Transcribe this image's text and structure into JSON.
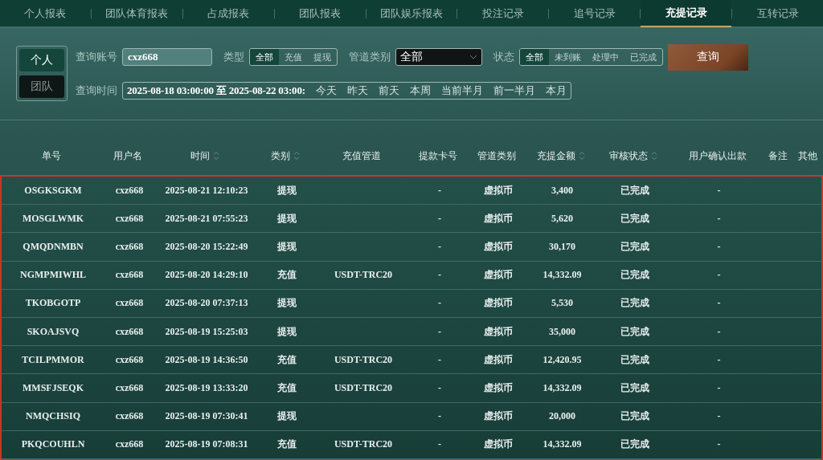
{
  "tabs": [
    {
      "label": "个人报表",
      "selected": false
    },
    {
      "label": "团队体育报表",
      "selected": false
    },
    {
      "label": "占成报表",
      "selected": false
    },
    {
      "label": "团队报表",
      "selected": false
    },
    {
      "label": "团队娱乐报表",
      "selected": false
    },
    {
      "label": "投注记录",
      "selected": false
    },
    {
      "label": "追号记录",
      "selected": false
    },
    {
      "label": "充提记录",
      "selected": true
    },
    {
      "label": "互转记录",
      "selected": false
    }
  ],
  "scope": [
    {
      "label": "个人",
      "selected": true
    },
    {
      "label": "团队",
      "selected": false
    }
  ],
  "filters": {
    "account_label": "查询账号",
    "account_value": "cxz668",
    "type_label": "类型",
    "type_options": [
      {
        "label": "全部",
        "selected": true
      },
      {
        "label": "充值",
        "selected": false
      },
      {
        "label": "提现",
        "selected": false
      }
    ],
    "channel_label": "管道类别",
    "channel_value": "全部",
    "status_label": "状态",
    "status_options": [
      {
        "label": "全部",
        "selected": true
      },
      {
        "label": "未到账",
        "selected": false
      },
      {
        "label": "处理中",
        "selected": false
      },
      {
        "label": "已完成",
        "selected": false
      }
    ],
    "query_button": "查询",
    "time_label": "查询时间",
    "time_range": "2025-08-18 03:00:00 至 2025-08-22 03:00:",
    "quick_ranges": [
      "今天",
      "昨天",
      "前天",
      "本周",
      "当前半月",
      "前一半月",
      "本月"
    ]
  },
  "table": {
    "columns": [
      {
        "label": "单号",
        "sortable": false
      },
      {
        "label": "用户名",
        "sortable": false
      },
      {
        "label": "时间",
        "sortable": true
      },
      {
        "label": "类别",
        "sortable": true
      },
      {
        "label": "充值管道",
        "sortable": false
      },
      {
        "label": "提款卡号",
        "sortable": false
      },
      {
        "label": "管道类别",
        "sortable": false
      },
      {
        "label": "充提金额",
        "sortable": true
      },
      {
        "label": "审核状态",
        "sortable": true
      },
      {
        "label": "用户确认出款",
        "sortable": false
      },
      {
        "label": "备注",
        "sortable": false
      },
      {
        "label": "其他",
        "sortable": false
      }
    ],
    "rows": [
      [
        "OSGKSGKM",
        "cxz668",
        "2025-08-21 12:10:23",
        "提现",
        "",
        "-",
        "虚拟币",
        "3,400",
        "已完成",
        "-"
      ],
      [
        "MOSGLWMK",
        "cxz668",
        "2025-08-21 07:55:23",
        "提现",
        "",
        "-",
        "虚拟币",
        "5,620",
        "已完成",
        "-"
      ],
      [
        "QMQDNMBN",
        "cxz668",
        "2025-08-20 15:22:49",
        "提现",
        "",
        "-",
        "虚拟币",
        "30,170",
        "已完成",
        "-"
      ],
      [
        "NGMPMIWHL",
        "cxz668",
        "2025-08-20 14:29:10",
        "充值",
        "USDT-TRC20",
        "-",
        "虚拟币",
        "14,332.09",
        "已完成",
        "-"
      ],
      [
        "TKOBGOTP",
        "cxz668",
        "2025-08-20 07:37:13",
        "提现",
        "",
        "-",
        "虚拟币",
        "5,530",
        "已完成",
        "-"
      ],
      [
        "SKOAJSVQ",
        "cxz668",
        "2025-08-19 15:25:03",
        "提现",
        "",
        "-",
        "虚拟币",
        "35,000",
        "已完成",
        "-"
      ],
      [
        "TCILPMMOR",
        "cxz668",
        "2025-08-19 14:36:50",
        "充值",
        "USDT-TRC20",
        "-",
        "虚拟币",
        "12,420.95",
        "已完成",
        "-"
      ],
      [
        "MMSFJSEQK",
        "cxz668",
        "2025-08-19 13:33:20",
        "充值",
        "USDT-TRC20",
        "-",
        "虚拟币",
        "14,332.09",
        "已完成",
        "-"
      ],
      [
        "NMQCHSIQ",
        "cxz668",
        "2025-08-19 07:30:41",
        "提现",
        "",
        "-",
        "虚拟币",
        "20,000",
        "已完成",
        "-"
      ],
      [
        "PKQCOUHLN",
        "cxz668",
        "2025-08-19 07:08:31",
        "充值",
        "USDT-TRC20",
        "-",
        "虚拟币",
        "14,332.09",
        "已完成",
        "-"
      ]
    ]
  }
}
